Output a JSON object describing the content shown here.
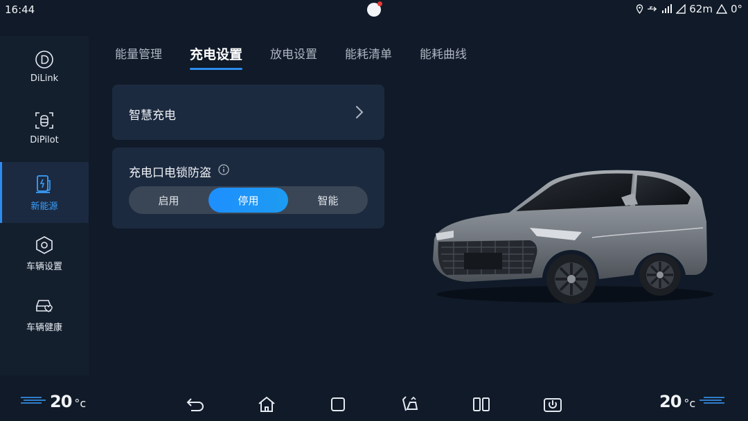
{
  "status_bar": {
    "time": "16:44",
    "distance": "62m",
    "temperature": "0°",
    "icons": [
      "location-icon",
      "usb-icon",
      "signal-icon",
      "network-icon",
      "weather-icon"
    ]
  },
  "sidebar": {
    "items": [
      {
        "label": "DiLink",
        "icon": "dilink-icon",
        "active": false
      },
      {
        "label": "DiPilot",
        "icon": "dipilot-icon",
        "active": false
      },
      {
        "label": "新能源",
        "icon": "charging-station-icon",
        "active": true
      },
      {
        "label": "车辆设置",
        "icon": "hexagon-settings-icon",
        "active": false
      },
      {
        "label": "车辆健康",
        "icon": "car-health-icon",
        "active": false
      }
    ]
  },
  "tabs": [
    {
      "label": "能量管理",
      "active": false
    },
    {
      "label": "充电设置",
      "active": true
    },
    {
      "label": "放电设置",
      "active": false
    },
    {
      "label": "能耗清单",
      "active": false
    },
    {
      "label": "能耗曲线",
      "active": false
    }
  ],
  "smart_charge": {
    "label": "智慧充电"
  },
  "charge_lock": {
    "label": "充电口电锁防盗",
    "options": [
      "启用",
      "停用",
      "智能"
    ],
    "selected": "停用"
  },
  "bottom_bar": {
    "left_temp": "20",
    "right_temp": "20",
    "unit": "°c",
    "nav": [
      "back-icon",
      "home-icon",
      "recent-apps-icon",
      "seat-icon",
      "split-screen-icon",
      "power-icon"
    ]
  },
  "colors": {
    "accent": "#2d8cf0",
    "background": "#101a28",
    "card": "#1c2a3f",
    "sidebar": "#141f2e"
  }
}
